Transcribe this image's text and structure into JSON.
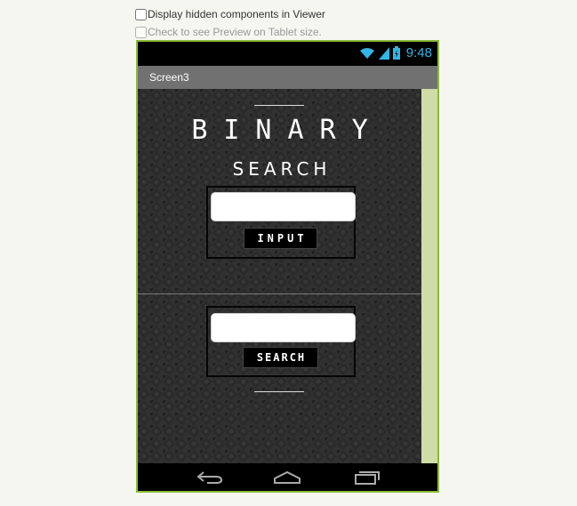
{
  "options": {
    "display_hidden": "Display hidden components in Viewer",
    "tablet_preview": "Check to see Preview on Tablet size."
  },
  "status_bar": {
    "time": "9:48",
    "icons": [
      "wifi-icon",
      "signal-icon",
      "battery-icon"
    ]
  },
  "screen": {
    "title": "Screen3"
  },
  "app": {
    "title_line1": "BINARY",
    "title_line2": "SEARCH",
    "input_button": "INPUT",
    "search_button": "SEARCH",
    "input_value": "",
    "search_value": ""
  },
  "nav": {
    "icons": [
      "back-icon",
      "home-icon",
      "recents-icon"
    ]
  },
  "colors": {
    "accent": "#8ab93a",
    "status_blue": "#33b5e5",
    "scrollbar": "#cfdca5"
  }
}
